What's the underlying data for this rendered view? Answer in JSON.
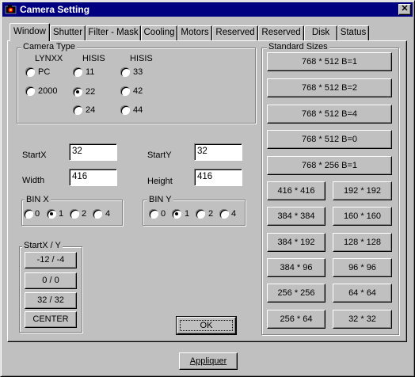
{
  "window": {
    "title": "Camera Setting",
    "icon": "camera-icon",
    "close_label": "✕",
    "title_bar_color": "#000080"
  },
  "tabs": [
    "Window",
    "Shutter",
    "Filter - Mask",
    "Cooling",
    "Motors",
    "Reserved",
    "Reserved",
    "Disk",
    "Status"
  ],
  "active_tab": "Window",
  "camera_type": {
    "label": "Camera Type",
    "col_headers": [
      "LYNXX",
      "HISIS",
      "HISIS"
    ],
    "options": [
      {
        "label": "PC",
        "selected": false
      },
      {
        "label": "2000",
        "selected": false
      },
      {
        "label": "11",
        "selected": false
      },
      {
        "label": "22",
        "selected": true
      },
      {
        "label": "24",
        "selected": false
      },
      {
        "label": "33",
        "selected": false
      },
      {
        "label": "42",
        "selected": false
      },
      {
        "label": "44",
        "selected": false
      }
    ]
  },
  "fields": {
    "startx": {
      "label": "StartX",
      "value": "32"
    },
    "starty": {
      "label": "StartY",
      "value": "32"
    },
    "width": {
      "label": "Width",
      "value": "416"
    },
    "height": {
      "label": "Height",
      "value": "416"
    }
  },
  "bin_x": {
    "label": "BIN  X",
    "options": [
      {
        "label": "0",
        "selected": false
      },
      {
        "label": "1",
        "selected": true
      },
      {
        "label": "2",
        "selected": false
      },
      {
        "label": "4",
        "selected": false
      }
    ]
  },
  "bin_y": {
    "label": "BIN Y",
    "options": [
      {
        "label": "0",
        "selected": false
      },
      {
        "label": "1",
        "selected": true
      },
      {
        "label": "2",
        "selected": false
      },
      {
        "label": "4",
        "selected": false
      }
    ]
  },
  "start_xy": {
    "label": "StartX / Y",
    "buttons": [
      "-12 / -4",
      "0  /  0",
      "32 / 32",
      "CENTER"
    ]
  },
  "standard_sizes": {
    "label": "Standard Sizes",
    "wide_buttons": [
      "768 * 512  B=1",
      "768 * 512  B=2",
      "768 * 512  B=4",
      "768 * 512  B=0",
      "768 * 256  B=1"
    ],
    "grid_buttons": [
      "416 * 416",
      "192 * 192",
      "384 * 384",
      "160 * 160",
      "384 * 192",
      "128 * 128",
      "384 * 96",
      "96 * 96",
      "256 * 256",
      "64 * 64",
      "256 * 64",
      "32 * 32"
    ]
  },
  "buttons": {
    "ok": "OK",
    "apply": "Appliquer"
  }
}
